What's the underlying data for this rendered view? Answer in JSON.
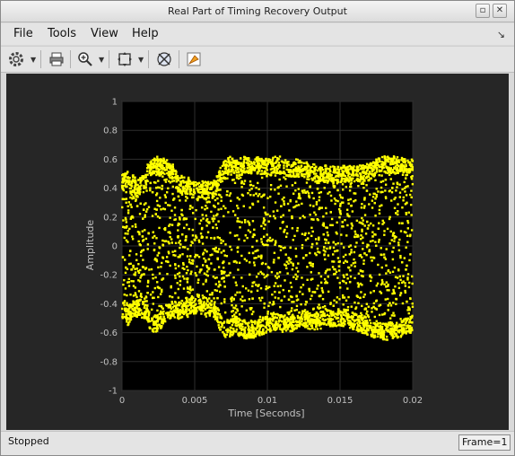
{
  "window": {
    "title": "Real Part of Timing Recovery Output"
  },
  "menu": {
    "file": "File",
    "tools": "Tools",
    "view": "View",
    "help": "Help"
  },
  "toolbar": {
    "icons": [
      "gear-icon",
      "print-icon",
      "zoom-in-icon",
      "autoscale-icon",
      "fit-icon",
      "highlight-icon"
    ]
  },
  "status": {
    "text": "Stopped",
    "frame": "Frame=1"
  },
  "chart_data": {
    "type": "scatter",
    "xlabel": "Time [Seconds]",
    "ylabel": "Amplitude",
    "xlim": [
      0,
      0.02
    ],
    "ylim": [
      -1,
      1
    ],
    "xticks": [
      0,
      0.005,
      0.01,
      0.015,
      0.02
    ],
    "xtick_labels": [
      "0",
      "0.005",
      "0.01",
      "0.015",
      "0.02"
    ],
    "yticks": [
      -1,
      -0.8,
      -0.6,
      -0.4,
      -0.2,
      0,
      0.2,
      0.4,
      0.6,
      0.8,
      1
    ],
    "ytick_labels": [
      "-1",
      "-0.8",
      "-0.6",
      "-0.4",
      "-0.2",
      "0",
      "0.2",
      "0.4",
      "0.6",
      "0.8",
      "1"
    ],
    "grid": true,
    "marker_color": "#ffff00",
    "background_color": "#000000",
    "series": [
      {
        "x": [
          0.0002,
          0.0004,
          0.0006,
          0.0008,
          0.001,
          0.0012,
          0.0014,
          0.0016,
          0.0018,
          0.002,
          0.0022,
          0.0024,
          0.0026,
          0.0028,
          0.003,
          0.0032,
          0.0034,
          0.0036,
          0.0038,
          0.004,
          0.0042,
          0.0044,
          0.0046,
          0.0048,
          0.005,
          0.0052,
          0.0054,
          0.0056,
          0.0058,
          0.006,
          0.0062,
          0.0064,
          0.0066,
          0.0068,
          0.007,
          0.0072,
          0.0074,
          0.0076,
          0.0078,
          0.008,
          0.0085,
          0.009,
          0.0095,
          0.01,
          0.0105,
          0.011,
          0.0115,
          0.012,
          0.0125,
          0.013,
          0.0135,
          0.014,
          0.0145,
          0.015,
          0.0155,
          0.016,
          0.0165,
          0.017,
          0.0175,
          0.018,
          0.0185,
          0.019,
          0.0195,
          0.02
        ],
        "y_upper": [
          0.5,
          0.52,
          0.48,
          0.5,
          0.45,
          0.48,
          0.52,
          0.5,
          0.58,
          0.6,
          0.62,
          0.62,
          0.6,
          0.6,
          0.62,
          0.6,
          0.58,
          0.55,
          0.5,
          0.48,
          0.5,
          0.46,
          0.48,
          0.45,
          0.46,
          0.44,
          0.45,
          0.46,
          0.44,
          0.45,
          0.46,
          0.45,
          0.5,
          0.55,
          0.58,
          0.6,
          0.62,
          0.62,
          0.6,
          0.6,
          0.62,
          0.6,
          0.62,
          0.6,
          0.62,
          0.62,
          0.6,
          0.6,
          0.58,
          0.58,
          0.55,
          0.56,
          0.55,
          0.55,
          0.56,
          0.55,
          0.56,
          0.57,
          0.6,
          0.62,
          0.62,
          0.62,
          0.6,
          0.6
        ],
        "y_lower": [
          -0.5,
          -0.55,
          -0.52,
          -0.5,
          -0.5,
          -0.48,
          -0.5,
          -0.5,
          -0.55,
          -0.58,
          -0.6,
          -0.6,
          -0.58,
          -0.55,
          -0.52,
          -0.52,
          -0.5,
          -0.5,
          -0.52,
          -0.5,
          -0.5,
          -0.48,
          -0.5,
          -0.45,
          -0.5,
          -0.45,
          -0.48,
          -0.45,
          -0.5,
          -0.48,
          -0.5,
          -0.5,
          -0.55,
          -0.6,
          -0.62,
          -0.64,
          -0.64,
          -0.62,
          -0.6,
          -0.62,
          -0.64,
          -0.64,
          -0.62,
          -0.6,
          -0.58,
          -0.6,
          -0.6,
          -0.58,
          -0.56,
          -0.58,
          -0.58,
          -0.56,
          -0.56,
          -0.55,
          -0.56,
          -0.58,
          -0.6,
          -0.62,
          -0.64,
          -0.65,
          -0.65,
          -0.64,
          -0.62,
          -0.6
        ]
      }
    ]
  }
}
